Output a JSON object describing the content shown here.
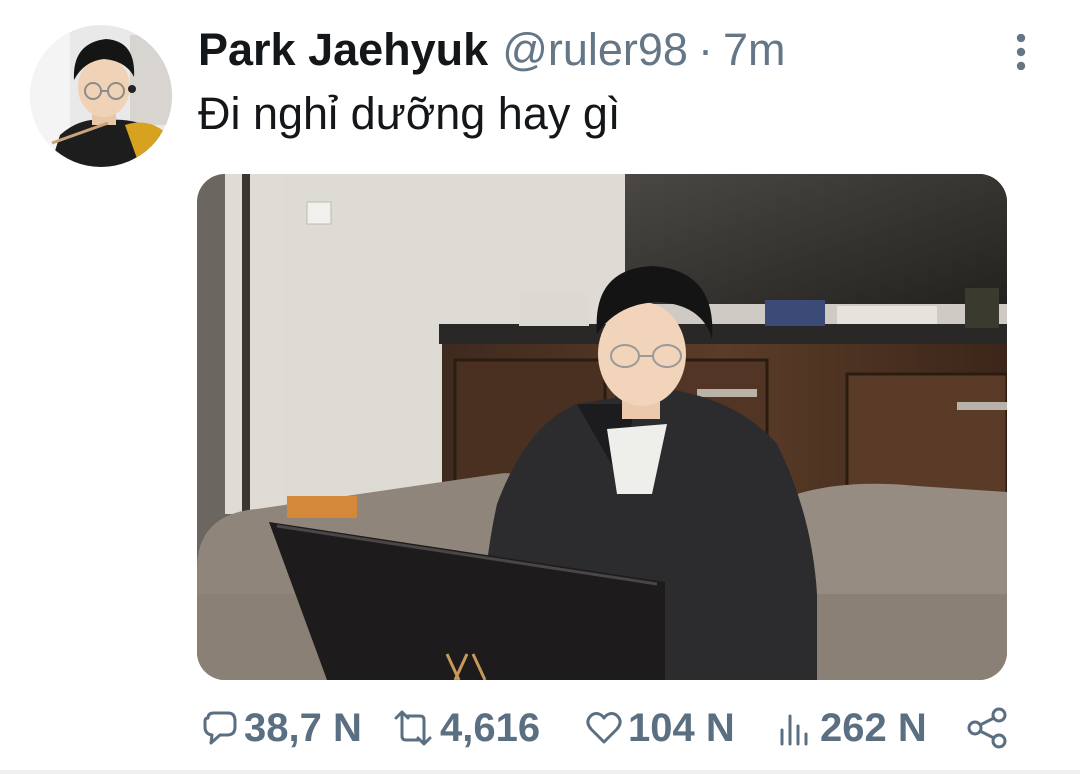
{
  "tweet": {
    "author_name": "Park Jaehyuk",
    "handle": "@ruler98",
    "separator": "·",
    "time": "7m",
    "text": "Đi nghỉ dưỡng hay gì"
  },
  "icons": {
    "more": "vertical-dots-icon",
    "reply": "speech-bubble-icon",
    "retweet": "retweet-arrows-icon",
    "like": "heart-icon",
    "views": "bar-chart-icon",
    "share": "share-nodes-icon"
  },
  "stats": {
    "replies": "38,7 N",
    "retweets": "4,616",
    "likes": "104 N",
    "views": "262 N"
  },
  "colors": {
    "text": "#14171a",
    "secondary": "#657786",
    "action": "#5b6f82"
  }
}
